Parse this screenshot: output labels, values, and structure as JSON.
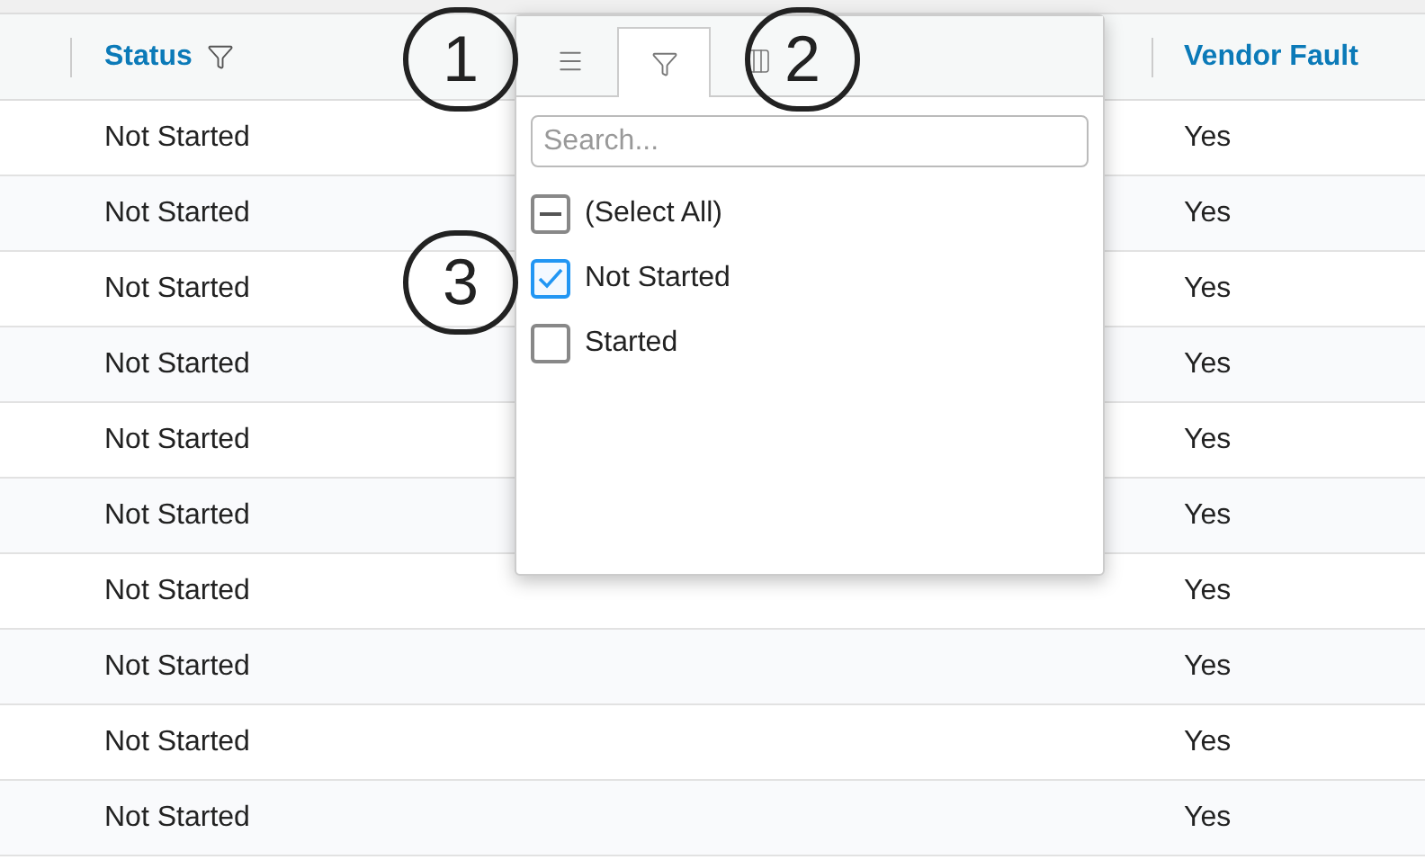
{
  "table": {
    "columns": [
      {
        "label": "Status",
        "filter": true
      },
      {
        "label": "Vendor Fault",
        "filter": false
      }
    ],
    "rows": [
      [
        "Not Started",
        "Yes"
      ],
      [
        "Not Started",
        "Yes"
      ],
      [
        "Not Started",
        "Yes"
      ],
      [
        "Not Started",
        "Yes"
      ],
      [
        "Not Started",
        "Yes"
      ],
      [
        "Not Started",
        "Yes"
      ],
      [
        "Not Started",
        "Yes"
      ],
      [
        "Not Started",
        "Yes"
      ],
      [
        "Not Started",
        "Yes"
      ],
      [
        "Not Started",
        "Yes"
      ]
    ]
  },
  "filter_popup": {
    "tabs": [
      {
        "kind": "menu",
        "selected": false
      },
      {
        "kind": "filter",
        "selected": true
      },
      {
        "kind": "columns",
        "selected": false
      }
    ],
    "search": {
      "placeholder": "Search..."
    },
    "options": [
      {
        "label": "(Select All)",
        "checked": false,
        "indeterminate": true
      },
      {
        "label": "Not Started",
        "checked": true,
        "indeterminate": false
      },
      {
        "label": "Started",
        "checked": false,
        "indeterminate": false
      }
    ]
  },
  "annotations": [
    {
      "text": "1"
    },
    {
      "text": "2"
    },
    {
      "text": "3"
    }
  ]
}
